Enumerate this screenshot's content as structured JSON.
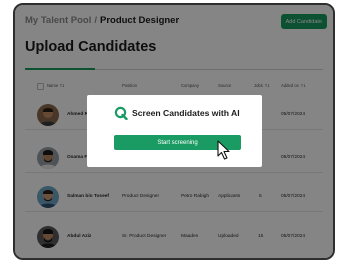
{
  "breadcrumb": {
    "root": "My Talent Pool",
    "separator": "/",
    "current": "Product Designer"
  },
  "header": {
    "add_button": "Add Candidate"
  },
  "page": {
    "title": "Upload Candidates"
  },
  "table": {
    "columns": {
      "name": "Name",
      "position": "Position",
      "company": "Company",
      "source": "Source",
      "jobs": "Jobs",
      "added_on": "Added on"
    },
    "rows": [
      {
        "name": "Ahmed Raza",
        "position": "",
        "company": "",
        "source": "",
        "jobs": "",
        "added_on": "05/07/2024",
        "avatar": "avatar-photo-1"
      },
      {
        "name": "Osama Farooq",
        "position": "",
        "company": "",
        "source": "",
        "jobs": "",
        "added_on": "05/07/2024",
        "avatar": "avatar-photo-2"
      },
      {
        "name": "Salman bin Toseef",
        "position": "Product Designer",
        "company": "Petro Rabigh",
        "source": "Applicants",
        "jobs": "6",
        "added_on": "05/07/2024",
        "avatar": "avatar-photo-3"
      },
      {
        "name": "Abdul Aziz",
        "position": "Sr. Product Designer",
        "company": "Maaden",
        "source": "Uploaded",
        "jobs": "15",
        "added_on": "05/07/2024",
        "avatar": "avatar-photo-4"
      }
    ]
  },
  "modal": {
    "title": "Screen Candidates with AI",
    "button": "Start screening",
    "logo_icon": "q-logo-icon"
  },
  "colors": {
    "accent": "#1a9b63",
    "overlay": "rgba(0,0,0,0.48)"
  }
}
